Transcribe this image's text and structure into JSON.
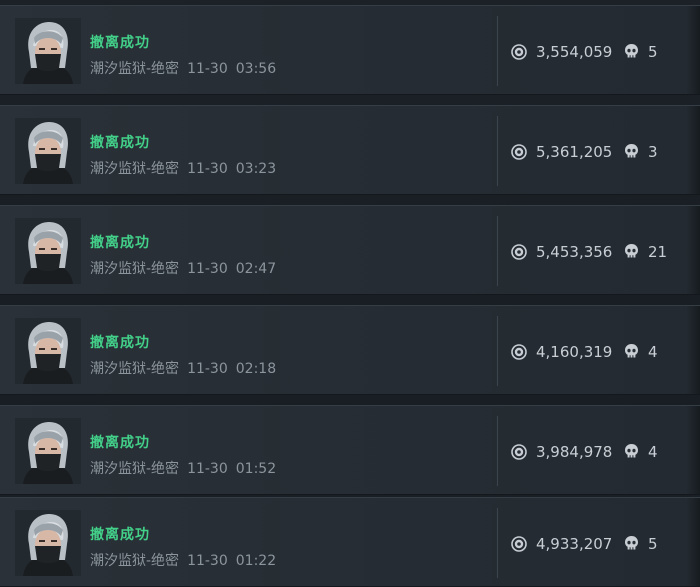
{
  "colors": {
    "status": "#43d18a",
    "meta": "#8c949c",
    "value": "#c8ced4",
    "row_bg": "#2a3138"
  },
  "icons": {
    "currency": "coin-icon",
    "kills": "skull-icon",
    "player": "avatar"
  },
  "records": [
    {
      "status": "撤离成功",
      "map": "潮汐监狱-绝密",
      "date": "11-30",
      "time": "03:56",
      "value": "3,554,059",
      "kills": "5"
    },
    {
      "status": "撤离成功",
      "map": "潮汐监狱-绝密",
      "date": "11-30",
      "time": "03:23",
      "value": "5,361,205",
      "kills": "3"
    },
    {
      "status": "撤离成功",
      "map": "潮汐监狱-绝密",
      "date": "11-30",
      "time": "02:47",
      "value": "5,453,356",
      "kills": "21"
    },
    {
      "status": "撤离成功",
      "map": "潮汐监狱-绝密",
      "date": "11-30",
      "time": "02:18",
      "value": "4,160,319",
      "kills": "4"
    },
    {
      "status": "撤离成功",
      "map": "潮汐监狱-绝密",
      "date": "11-30",
      "time": "01:52",
      "value": "3,984,978",
      "kills": "4"
    },
    {
      "status": "撤离成功",
      "map": "潮汐监狱-绝密",
      "date": "11-30",
      "time": "01:22",
      "value": "4,933,207",
      "kills": "5"
    }
  ]
}
